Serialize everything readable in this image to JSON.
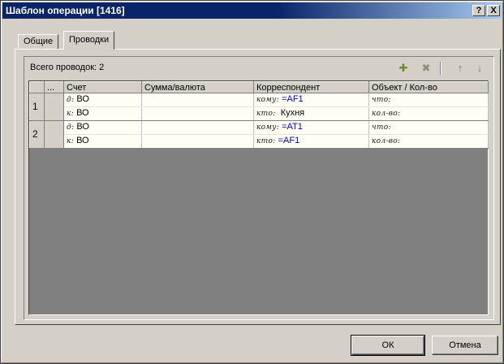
{
  "window": {
    "title": "Шаблон операции [1416]",
    "help_label": "?",
    "close_label": "X"
  },
  "tabs": [
    {
      "label": "Общие",
      "active": false
    },
    {
      "label": "Проводки",
      "active": true
    }
  ],
  "summary": {
    "count_text": "Всего проводок: 2"
  },
  "toolbar": {
    "add_icon": "add-entry-icon",
    "delete_icon": "delete-entry-icon",
    "up_icon": "arrow-up-icon",
    "down_icon": "arrow-down-icon"
  },
  "grid": {
    "columns": [
      "",
      "...",
      "Счет",
      "Сумма/валюта",
      "Корреспондент",
      "Объект / Кол-во"
    ],
    "entries": [
      {
        "number": "1",
        "debit": {
          "prefix": "д:",
          "account": "ВО",
          "corr_prefix": "кому:",
          "corr_value": "=AF1",
          "obj": "что:"
        },
        "credit": {
          "prefix": "к:",
          "account": "ВО",
          "corr_prefix": "кто:",
          "corr_value": "Кухня",
          "obj": "кол-во:"
        }
      },
      {
        "number": "2",
        "debit": {
          "prefix": "д:",
          "account": "ВО",
          "corr_prefix": "кому:",
          "corr_value": "=AT1",
          "obj": "что:"
        },
        "credit": {
          "prefix": "к:",
          "account": "ВО",
          "corr_prefix": "кто:",
          "corr_value": "=AF1",
          "obj": "кол-во:"
        }
      }
    ]
  },
  "buttons": {
    "ok": "ОК",
    "cancel": "Отмена"
  },
  "colors": {
    "titlebar": "#0a246a",
    "grid_row_bg": "#fffef4",
    "link_value": "#0000cc"
  }
}
